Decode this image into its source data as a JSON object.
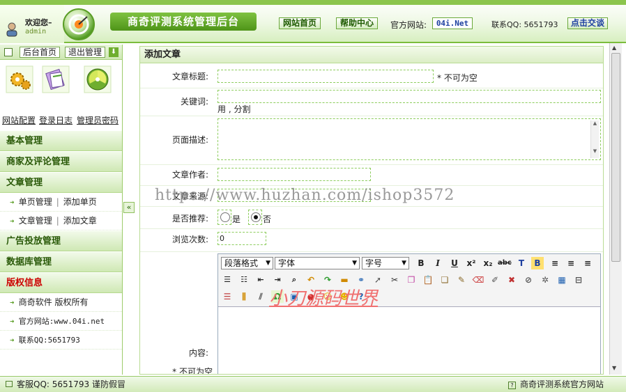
{
  "header": {
    "welcome": "欢迎您–",
    "username": "admin",
    "title": "商奇评测系统管理后台",
    "home_link": "网站首页",
    "help_link": "帮助中心",
    "official_label": "官方网站:",
    "official_site": "04i.Net",
    "qq_label": "联系QQ: 5651793",
    "chat_button": "点击交谈"
  },
  "sidebar": {
    "home_button": "后台首页",
    "logout_button": "退出管理",
    "quick_links": [
      "网站配置",
      "登录日志",
      "管理员密码"
    ],
    "sections": {
      "basic": "基本管理",
      "merchant": "商家及评论管理",
      "article": "文章管理",
      "ads": "广告投放管理",
      "db": "数据库管理",
      "copyright": "版权信息"
    },
    "article_items": {
      "single_page": "单页管理",
      "add_single": "添加单页",
      "article_manage": "文章管理",
      "add_article": "添加文章"
    },
    "copyright_items": {
      "line1": "商奇软件 版权所有",
      "line2": "官方网站:www.04i.net",
      "line3": "联系QQ:5651793"
    }
  },
  "form": {
    "panel_title": "添加文章",
    "title_label": "文章标题:",
    "title_note": "* 不可为空",
    "keywords_label": "关键词:",
    "keywords_note": "用 , 分割",
    "description_label": "页面描述:",
    "author_label": "文章作者:",
    "source_label": "文章来源:",
    "recommend_label": "是否推荐:",
    "recommend_yes": "是",
    "recommend_no": "否",
    "recommend_selected": "否",
    "views_label": "浏览次数:",
    "views_value": "0",
    "content_label": "内容:",
    "content_note": "* 不可为空"
  },
  "editor": {
    "paragraph_select": "段落格式",
    "font_select": "字体",
    "size_select": "字号"
  },
  "overlay": {
    "watermark": "https://www.huzhan.com/ishop3572",
    "signature": "小刀源码世界"
  },
  "footer": {
    "left": "客服QQ: 5651793 谨防假冒",
    "right": "商奇评测系统官方网站"
  },
  "colors": {
    "accent": "#5a9d25",
    "header_green": "#7bbd3c",
    "red": "#cc0000"
  }
}
